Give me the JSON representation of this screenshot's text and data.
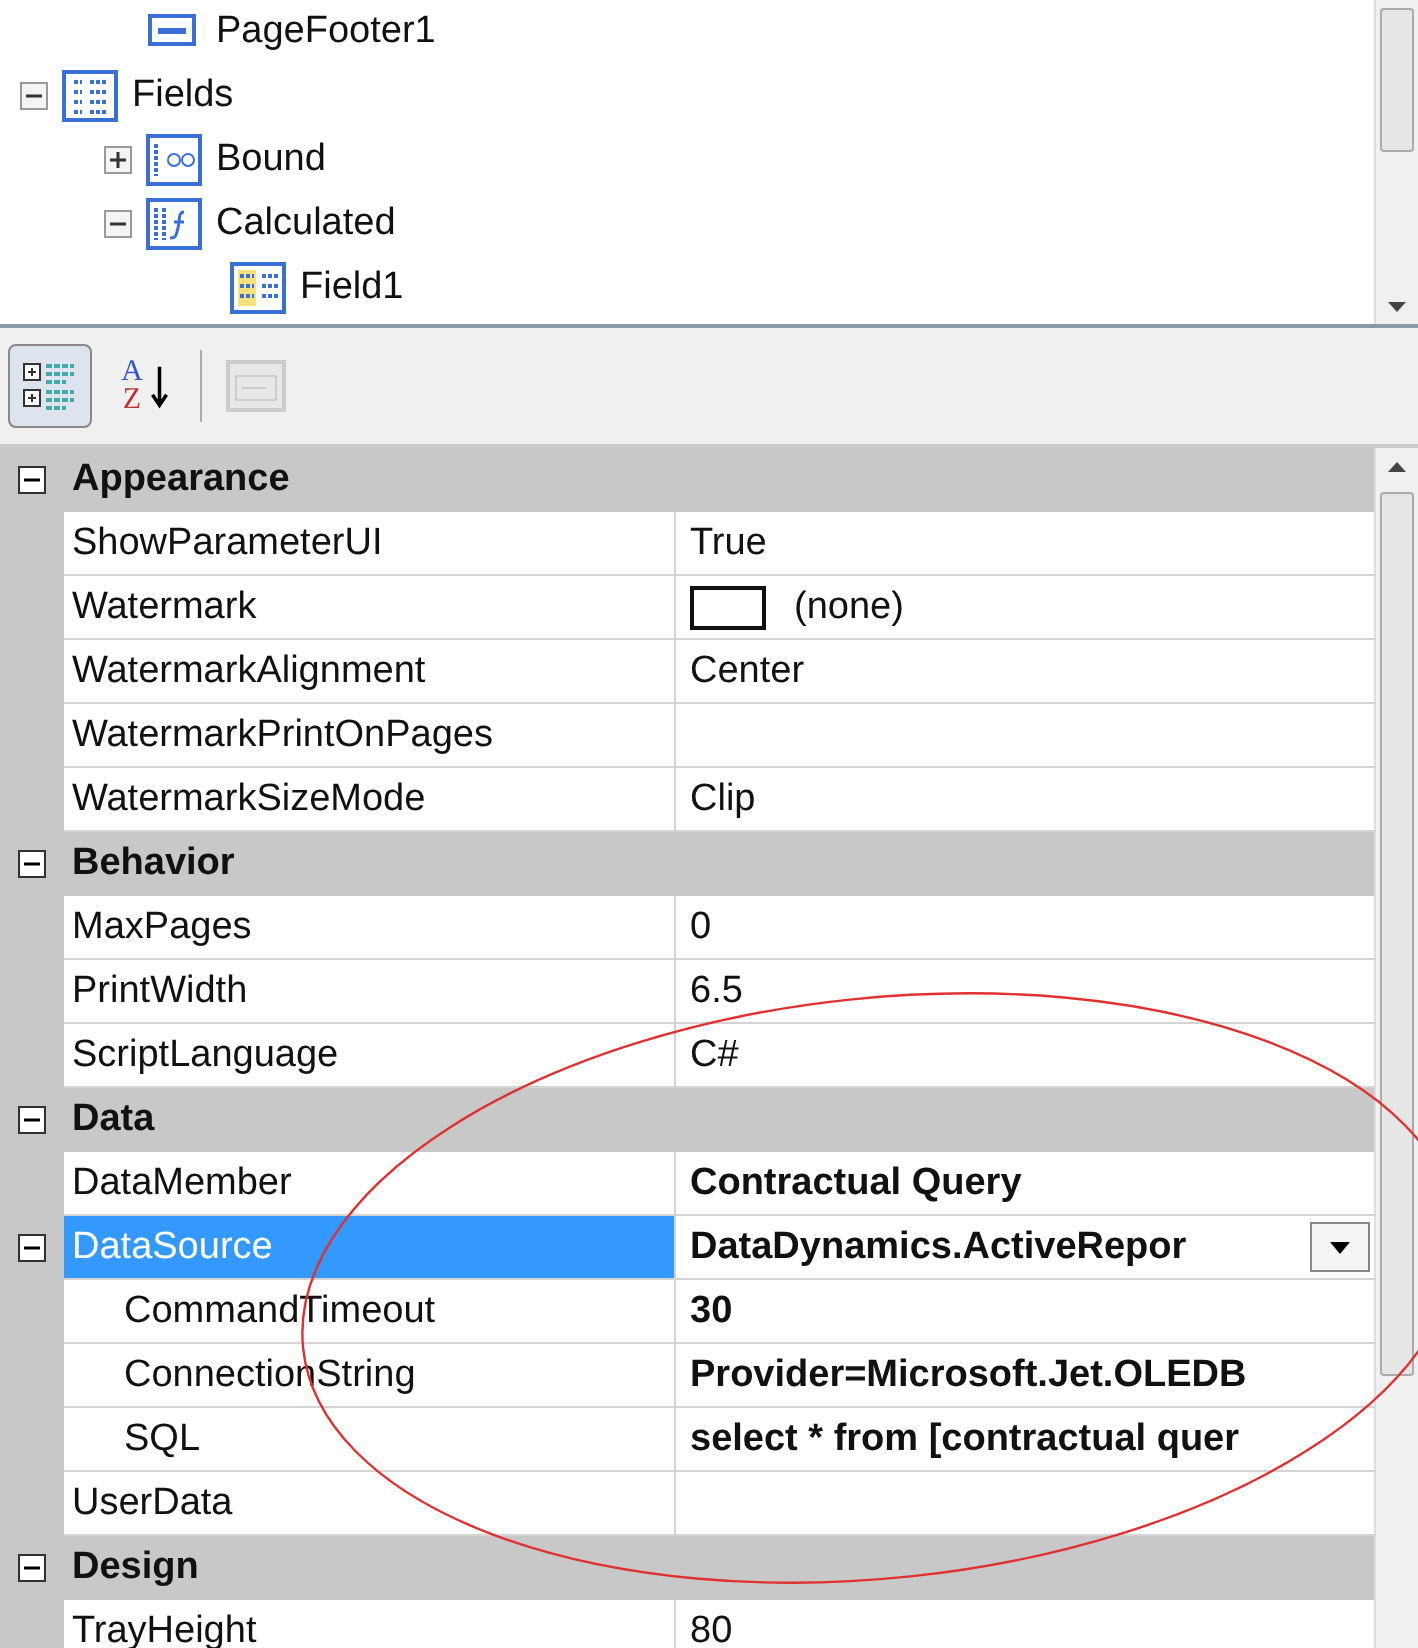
{
  "tree": {
    "items_above": [
      {
        "label": "PageFooter1",
        "kind": "section"
      }
    ],
    "nodes": [
      {
        "label": "Fields",
        "kind": "fields",
        "expanded": true,
        "children": [
          {
            "label": "Bound",
            "kind": "bound",
            "expanded": false
          },
          {
            "label": "Calculated",
            "kind": "calculated",
            "expanded": true,
            "children": [
              {
                "label": "Field1",
                "kind": "field"
              }
            ]
          }
        ]
      }
    ]
  },
  "toolbar": [
    {
      "kind": "categorized",
      "selected": true,
      "disabled": false
    },
    {
      "kind": "alphabetical",
      "selected": false,
      "disabled": false,
      "letters": [
        "A",
        "Z"
      ]
    },
    {
      "kind": "property-pages",
      "selected": false,
      "disabled": true
    }
  ],
  "categories": [
    {
      "name": "Appearance",
      "expanded": true,
      "properties": [
        {
          "name": "ShowParameterUI",
          "value": "True",
          "kind": "text",
          "bold": false,
          "selected": false
        },
        {
          "name": "Watermark",
          "value": "(none)",
          "kind": "swatch",
          "bold": false,
          "selected": false
        },
        {
          "name": "WatermarkAlignment",
          "value": "Center",
          "kind": "text",
          "bold": false,
          "selected": false
        },
        {
          "name": "WatermarkPrintOnPages",
          "kind": "text",
          "selected": false
        },
        {
          "name": "WatermarkSizeMode",
          "value": "Clip",
          "kind": "text",
          "bold": false,
          "selected": false
        }
      ]
    },
    {
      "name": "Behavior",
      "expanded": true,
      "properties": [
        {
          "name": "MaxPages",
          "value": "0",
          "kind": "text",
          "bold": false,
          "selected": false
        },
        {
          "name": "PrintWidth",
          "value": "6.5",
          "kind": "text",
          "bold": false,
          "selected": false
        },
        {
          "name": "ScriptLanguage",
          "value": "C#",
          "kind": "text",
          "bold": false,
          "selected": false
        }
      ]
    },
    {
      "name": "Data",
      "expanded": true,
      "properties": [
        {
          "name": "DataMember",
          "value": "Contractual Query",
          "kind": "text",
          "bold": true,
          "selected": false
        },
        {
          "name": "DataSource",
          "value": "DataDynamics.ActiveRepor",
          "kind": "dropdown",
          "bold": true,
          "selected": true,
          "expanded": true,
          "children": [
            {
              "name": "CommandTimeout",
              "value": "30",
              "kind": "text",
              "bold": true,
              "selected": false
            },
            {
              "name": "ConnectionString",
              "value": "Provider=Microsoft.Jet.OLEDB",
              "kind": "text",
              "bold": true,
              "selected": false
            },
            {
              "name": "SQL",
              "value": "select * from [contractual quer",
              "kind": "text",
              "bold": true,
              "selected": false
            }
          ]
        },
        {
          "name": "UserData",
          "kind": "text",
          "selected": false
        }
      ]
    },
    {
      "name": "Design",
      "expanded": true,
      "properties": [
        {
          "name": "TrayHeight",
          "value": "80",
          "kind": "text",
          "bold": false,
          "selected": false
        }
      ]
    }
  ]
}
